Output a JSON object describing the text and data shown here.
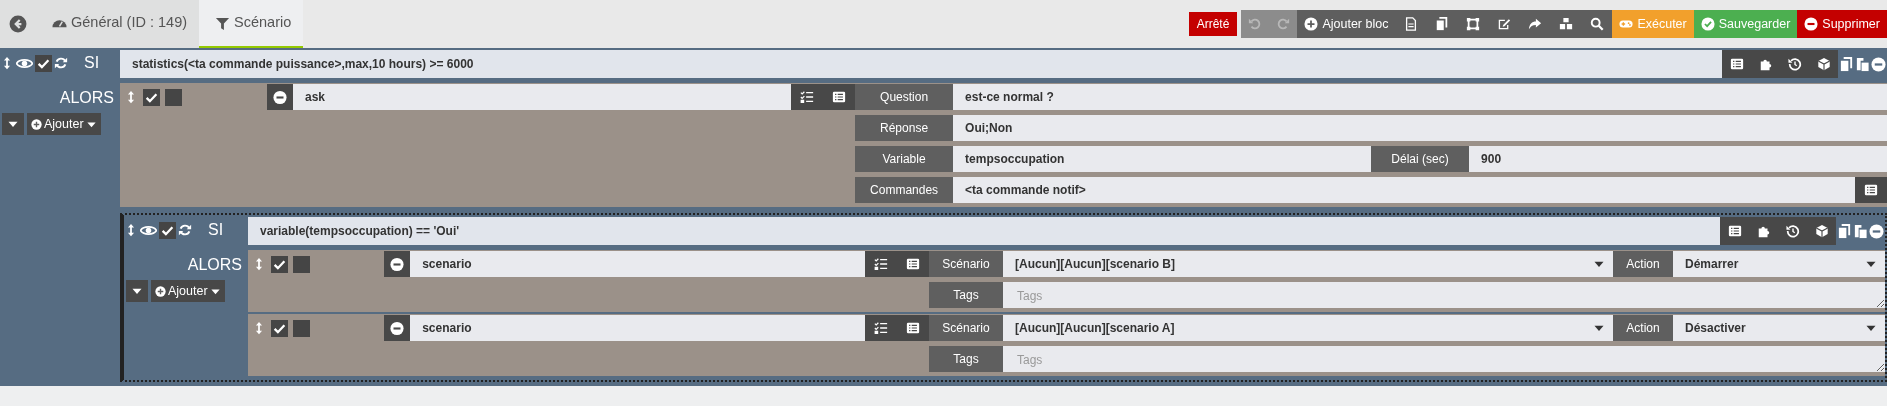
{
  "tabs": [
    {
      "label": "Général (ID : 149)",
      "kind": "general",
      "selected": false
    },
    {
      "label": "Scénario",
      "kind": "scenario",
      "selected": true
    }
  ],
  "state_badge": "Arrêté",
  "undo": {
    "disabled": true
  },
  "redo": {
    "disabled": true
  },
  "add_block": "Ajouter bloc",
  "buttons": [
    {
      "label": "Exécuter",
      "kind": "run"
    },
    {
      "label": "Sauvegarder",
      "kind": "save"
    },
    {
      "label": "Supprimer",
      "kind": "delete"
    }
  ],
  "blocks": [
    {
      "keyword": "SI",
      "then_label": "ALORS",
      "add_label": "Ajouter",
      "enabled": true,
      "condition": "statistics(<ta commande puissance>,max,10 hours)  >= 6000",
      "actions": [
        {
          "kind": "action",
          "enabled": true,
          "parallel": false,
          "command": "ask",
          "rows": [
            [
              {
                "label": "Question",
                "value": "est-ce normal ?",
                "kind": "text"
              }
            ],
            [
              {
                "label": "Réponse",
                "value": "Oui;Non",
                "kind": "text"
              }
            ],
            [
              {
                "label": "Variable",
                "value": "tempsoccupation",
                "kind": "text"
              },
              {
                "label": "Délai (sec)",
                "value": "900",
                "kind": "text"
              }
            ],
            [
              {
                "label": "Commandes",
                "value": "<ta commande notif>",
                "kind": "command"
              }
            ]
          ]
        },
        {
          "kind": "block",
          "keyword": "SI",
          "then_label": "ALORS",
          "add_label": "Ajouter",
          "enabled": true,
          "condition": "variable(tempsoccupation) == 'Oui'",
          "actions": [
            {
              "kind": "action",
              "enabled": true,
              "parallel": false,
              "command": "scenario",
              "rows": [
                [
                  {
                    "label": "Scénario",
                    "value": "[Aucun][Aucun][scenario B]",
                    "kind": "select"
                  },
                  {
                    "label": "Action",
                    "value": "Démarrer",
                    "kind": "select"
                  }
                ],
                [
                  {
                    "label": "Tags",
                    "placeholder": "Tags",
                    "kind": "textarea"
                  }
                ]
              ]
            },
            {
              "kind": "action",
              "enabled": true,
              "parallel": false,
              "command": "scenario",
              "rows": [
                [
                  {
                    "label": "Scénario",
                    "value": "[Aucun][Aucun][scenario A]",
                    "kind": "select"
                  },
                  {
                    "label": "Action",
                    "value": "Désactiver",
                    "kind": "select"
                  }
                ],
                [
                  {
                    "label": "Tags",
                    "placeholder": "Tags",
                    "kind": "textarea"
                  }
                ]
              ]
            }
          ]
        }
      ]
    }
  ]
}
